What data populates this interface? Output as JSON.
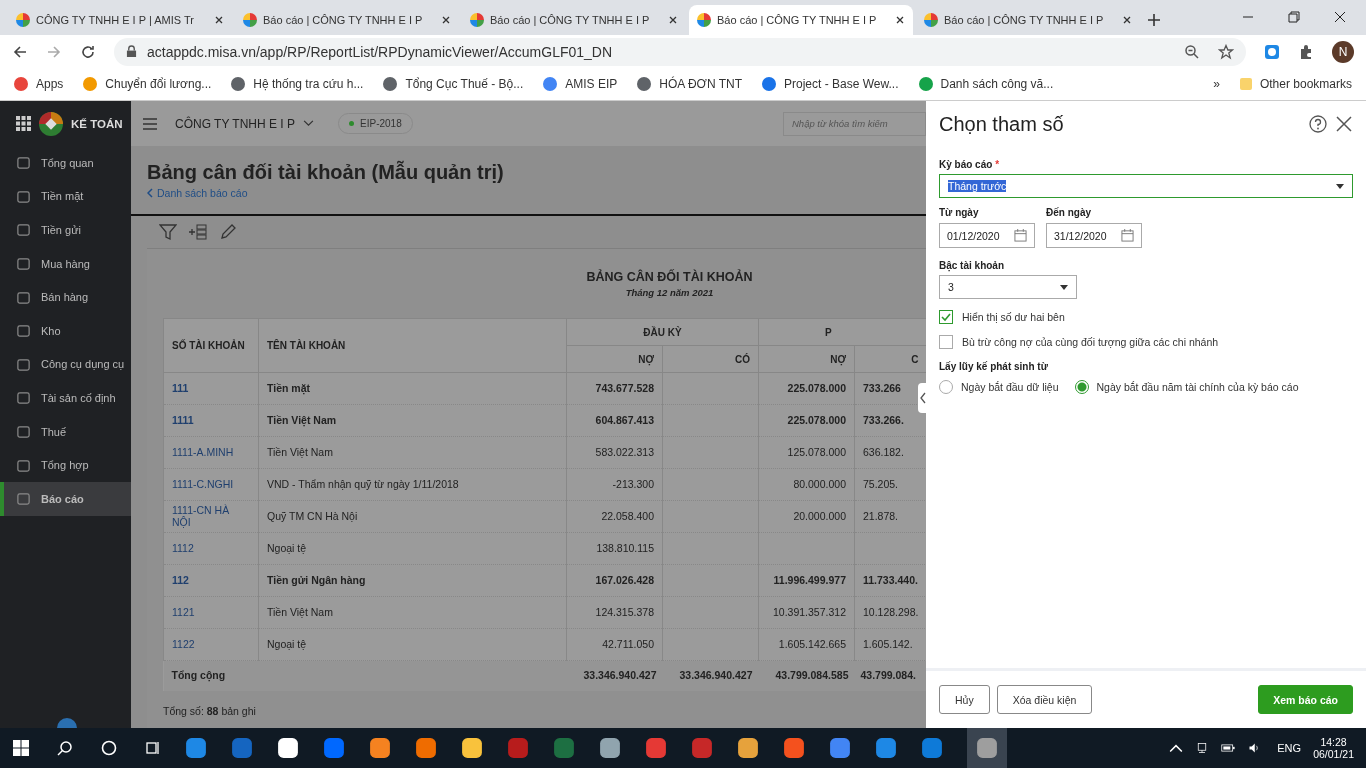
{
  "browser": {
    "tabs": [
      {
        "title": "CÔNG TY TNHH E I P | AMIS Tr",
        "selected": false
      },
      {
        "title": "Báo cáo | CÔNG TY TNHH E I P",
        "selected": false
      },
      {
        "title": "Báo cáo | CÔNG TY TNHH E I P",
        "selected": false
      },
      {
        "title": "Báo cáo | CÔNG TY TNHH E I P",
        "selected": true
      },
      {
        "title": "Báo cáo | CÔNG TY TNHH E I P",
        "selected": false
      }
    ],
    "url": "actappdc.misa.vn/app/RP/ReportList/RPDynamicViewer/AccumGLF01_DN",
    "profile": "N",
    "bookmarks": [
      "Apps",
      "Chuyển đổi lương...",
      "Hệ thống tra cứu h...",
      "Tổng Cục Thuế - Bộ...",
      "AMIS EIP",
      "HÓA ĐƠN TNT",
      "Project - Base Wew...",
      "Danh sách công vă..."
    ],
    "more": "»",
    "other_bookmarks": "Other bookmarks"
  },
  "app": {
    "brand": "KẾ TOÁN",
    "company": "CÔNG TY TNHH E I P",
    "database": "EIP-2018",
    "search_placeholder": "Nhập từ khóa tìm kiếm"
  },
  "sidebar": {
    "items": [
      {
        "label": "Tổng quan",
        "selected": false
      },
      {
        "label": "Tiền mặt",
        "selected": false
      },
      {
        "label": "Tiền gửi",
        "selected": false
      },
      {
        "label": "Mua hàng",
        "selected": false
      },
      {
        "label": "Bán hàng",
        "selected": false
      },
      {
        "label": "Kho",
        "selected": false
      },
      {
        "label": "Công cụ dụng cụ",
        "selected": false
      },
      {
        "label": "Tài sản cố định",
        "selected": false
      },
      {
        "label": "Thuế",
        "selected": false
      },
      {
        "label": "Tổng hợp",
        "selected": false
      },
      {
        "label": "Báo cáo",
        "selected": true
      }
    ]
  },
  "page": {
    "title": "Bảng cân đối tài khoản (Mẫu quản trị)",
    "back_link": "Danh sách báo cáo"
  },
  "report": {
    "title": "BẢNG CÂN ĐỐI TÀI KHOẢN",
    "subtitle": "Tháng 12 năm 2021",
    "columns": {
      "account": "SỐ TÀI KHOẢN",
      "name": "TÊN TÀI KHOẢN",
      "opening": "ĐẦU KỲ",
      "period": "P",
      "debit": "NỢ",
      "credit": "CÓ",
      "debit_2": "NỢ",
      "credit_2": "C"
    },
    "rows": [
      {
        "account": "111",
        "name": "Tiền mặt",
        "bold": true,
        "opening_debit": "743.677.528",
        "period_debit": "225.078.000",
        "period_credit": "733.266"
      },
      {
        "account": "1111",
        "name": "Tiền Việt Nam",
        "bold": true,
        "opening_debit": "604.867.413",
        "period_debit": "225.078.000",
        "period_credit": "733.266."
      },
      {
        "account": "1111-A.MINH",
        "name": "Tiền Việt Nam",
        "bold": false,
        "opening_debit": "583.022.313",
        "period_debit": "125.078.000",
        "period_credit": "636.182."
      },
      {
        "account": "1111-C.NGHI",
        "name": "VND - Thẩm nhận quỹ từ ngày 1/11/2018",
        "bold": false,
        "opening_debit": "-213.300",
        "period_debit": "80.000.000",
        "period_credit": "75.205."
      },
      {
        "account": "1111-CN HÀ NỘI",
        "name": "Quỹ TM CN Hà Nội",
        "bold": false,
        "opening_debit": "22.058.400",
        "period_debit": "20.000.000",
        "period_credit": "21.878."
      },
      {
        "account": "1112",
        "name": "Ngoại tệ",
        "bold": false,
        "opening_debit": "138.810.115"
      },
      {
        "account": "112",
        "name": "Tiền gửi Ngân hàng",
        "bold": true,
        "opening_debit": "167.026.428",
        "period_debit": "11.996.499.977",
        "period_credit": "11.733.440."
      },
      {
        "account": "1121",
        "name": "Tiền Việt Nam",
        "bold": false,
        "opening_debit": "124.315.378",
        "period_debit": "10.391.357.312",
        "period_credit": "10.128.298."
      },
      {
        "account": "1122",
        "name": "Ngoại tệ",
        "bold": false,
        "opening_debit": "42.711.050",
        "period_debit": "1.605.142.665",
        "period_credit": "1.605.142."
      }
    ],
    "total": {
      "label": "Tổng cộng",
      "values": [
        "33.346.940.427",
        "33.346.940.427",
        "43.799.084.585",
        "43.799.084."
      ]
    },
    "record_count": "Tổng số: **88** bản ghi"
  },
  "panel": {
    "title": "Chọn tham số",
    "period_label": "Kỳ báo cáo",
    "required_mark": "*",
    "period_value": "Tháng trước",
    "from_label": "Từ ngày",
    "from_value": "01/12/2020",
    "to_label": "Đến ngày",
    "to_value": "31/12/2020",
    "level_label": "Bậc tài khoản",
    "level_value": "3",
    "checkboxes": [
      {
        "label": "Hiển thị số dư hai bên",
        "checked": true
      },
      {
        "label": "Bù trừ công nợ của cùng đối tượng giữa các chi nhánh",
        "checked": false
      }
    ],
    "accumulate_label": "Lấy lũy kế phát sinh từ",
    "radios": [
      {
        "label": "Ngày bắt đầu dữ liệu",
        "selected": false
      },
      {
        "label": "Ngày bắt đầu năm tài chính của kỳ báo cáo",
        "selected": true
      }
    ],
    "buttons": [
      {
        "label": "Hủy",
        "kind": "plain"
      },
      {
        "label": "Xóa điều kiện",
        "kind": "plain"
      },
      {
        "label": "Xem báo cáo",
        "kind": "primary"
      }
    ]
  },
  "taskbar": {
    "language": "ENG",
    "time": "14:28",
    "date": "06/01/21"
  }
}
